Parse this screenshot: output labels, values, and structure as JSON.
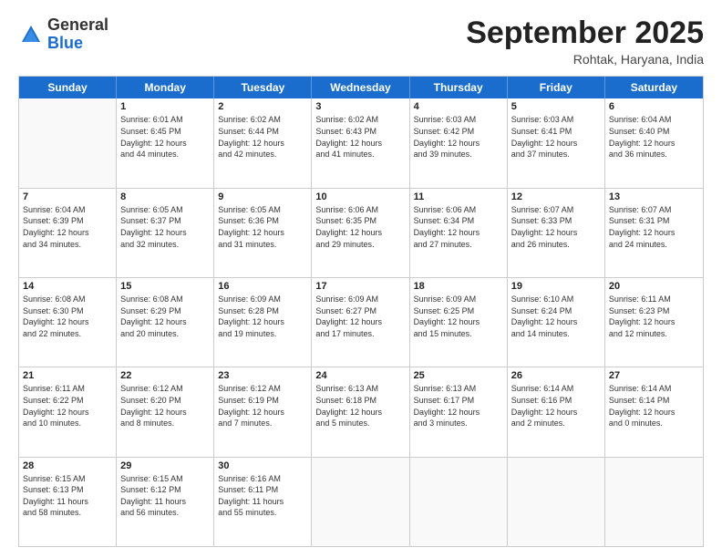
{
  "logo": {
    "general": "General",
    "blue": "Blue"
  },
  "title": "September 2025",
  "location": "Rohtak, Haryana, India",
  "header_days": [
    "Sunday",
    "Monday",
    "Tuesday",
    "Wednesday",
    "Thursday",
    "Friday",
    "Saturday"
  ],
  "rows": [
    [
      {
        "day": "",
        "detail": ""
      },
      {
        "day": "1",
        "detail": "Sunrise: 6:01 AM\nSunset: 6:45 PM\nDaylight: 12 hours\nand 44 minutes."
      },
      {
        "day": "2",
        "detail": "Sunrise: 6:02 AM\nSunset: 6:44 PM\nDaylight: 12 hours\nand 42 minutes."
      },
      {
        "day": "3",
        "detail": "Sunrise: 6:02 AM\nSunset: 6:43 PM\nDaylight: 12 hours\nand 41 minutes."
      },
      {
        "day": "4",
        "detail": "Sunrise: 6:03 AM\nSunset: 6:42 PM\nDaylight: 12 hours\nand 39 minutes."
      },
      {
        "day": "5",
        "detail": "Sunrise: 6:03 AM\nSunset: 6:41 PM\nDaylight: 12 hours\nand 37 minutes."
      },
      {
        "day": "6",
        "detail": "Sunrise: 6:04 AM\nSunset: 6:40 PM\nDaylight: 12 hours\nand 36 minutes."
      }
    ],
    [
      {
        "day": "7",
        "detail": "Sunrise: 6:04 AM\nSunset: 6:39 PM\nDaylight: 12 hours\nand 34 minutes."
      },
      {
        "day": "8",
        "detail": "Sunrise: 6:05 AM\nSunset: 6:37 PM\nDaylight: 12 hours\nand 32 minutes."
      },
      {
        "day": "9",
        "detail": "Sunrise: 6:05 AM\nSunset: 6:36 PM\nDaylight: 12 hours\nand 31 minutes."
      },
      {
        "day": "10",
        "detail": "Sunrise: 6:06 AM\nSunset: 6:35 PM\nDaylight: 12 hours\nand 29 minutes."
      },
      {
        "day": "11",
        "detail": "Sunrise: 6:06 AM\nSunset: 6:34 PM\nDaylight: 12 hours\nand 27 minutes."
      },
      {
        "day": "12",
        "detail": "Sunrise: 6:07 AM\nSunset: 6:33 PM\nDaylight: 12 hours\nand 26 minutes."
      },
      {
        "day": "13",
        "detail": "Sunrise: 6:07 AM\nSunset: 6:31 PM\nDaylight: 12 hours\nand 24 minutes."
      }
    ],
    [
      {
        "day": "14",
        "detail": "Sunrise: 6:08 AM\nSunset: 6:30 PM\nDaylight: 12 hours\nand 22 minutes."
      },
      {
        "day": "15",
        "detail": "Sunrise: 6:08 AM\nSunset: 6:29 PM\nDaylight: 12 hours\nand 20 minutes."
      },
      {
        "day": "16",
        "detail": "Sunrise: 6:09 AM\nSunset: 6:28 PM\nDaylight: 12 hours\nand 19 minutes."
      },
      {
        "day": "17",
        "detail": "Sunrise: 6:09 AM\nSunset: 6:27 PM\nDaylight: 12 hours\nand 17 minutes."
      },
      {
        "day": "18",
        "detail": "Sunrise: 6:09 AM\nSunset: 6:25 PM\nDaylight: 12 hours\nand 15 minutes."
      },
      {
        "day": "19",
        "detail": "Sunrise: 6:10 AM\nSunset: 6:24 PM\nDaylight: 12 hours\nand 14 minutes."
      },
      {
        "day": "20",
        "detail": "Sunrise: 6:11 AM\nSunset: 6:23 PM\nDaylight: 12 hours\nand 12 minutes."
      }
    ],
    [
      {
        "day": "21",
        "detail": "Sunrise: 6:11 AM\nSunset: 6:22 PM\nDaylight: 12 hours\nand 10 minutes."
      },
      {
        "day": "22",
        "detail": "Sunrise: 6:12 AM\nSunset: 6:20 PM\nDaylight: 12 hours\nand 8 minutes."
      },
      {
        "day": "23",
        "detail": "Sunrise: 6:12 AM\nSunset: 6:19 PM\nDaylight: 12 hours\nand 7 minutes."
      },
      {
        "day": "24",
        "detail": "Sunrise: 6:13 AM\nSunset: 6:18 PM\nDaylight: 12 hours\nand 5 minutes."
      },
      {
        "day": "25",
        "detail": "Sunrise: 6:13 AM\nSunset: 6:17 PM\nDaylight: 12 hours\nand 3 minutes."
      },
      {
        "day": "26",
        "detail": "Sunrise: 6:14 AM\nSunset: 6:16 PM\nDaylight: 12 hours\nand 2 minutes."
      },
      {
        "day": "27",
        "detail": "Sunrise: 6:14 AM\nSunset: 6:14 PM\nDaylight: 12 hours\nand 0 minutes."
      }
    ],
    [
      {
        "day": "28",
        "detail": "Sunrise: 6:15 AM\nSunset: 6:13 PM\nDaylight: 11 hours\nand 58 minutes."
      },
      {
        "day": "29",
        "detail": "Sunrise: 6:15 AM\nSunset: 6:12 PM\nDaylight: 11 hours\nand 56 minutes."
      },
      {
        "day": "30",
        "detail": "Sunrise: 6:16 AM\nSunset: 6:11 PM\nDaylight: 11 hours\nand 55 minutes."
      },
      {
        "day": "",
        "detail": ""
      },
      {
        "day": "",
        "detail": ""
      },
      {
        "day": "",
        "detail": ""
      },
      {
        "day": "",
        "detail": ""
      }
    ]
  ]
}
